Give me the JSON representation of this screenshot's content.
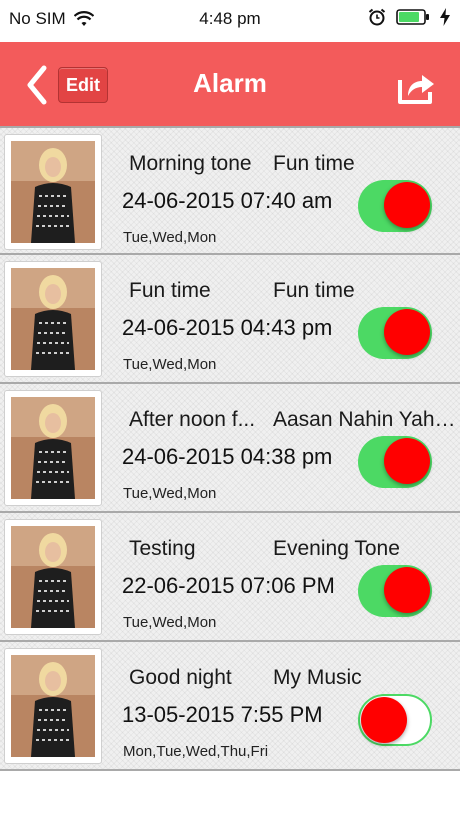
{
  "status_bar": {
    "carrier": "No SIM",
    "time": "4:48 pm"
  },
  "header": {
    "edit_label": "Edit",
    "title": "Alarm",
    "bg_color": "#f35b5b",
    "icons": [
      "chevron-left-icon",
      "share-icon"
    ]
  },
  "alarms": [
    {
      "name": "Morning tone",
      "tone": "Fun time",
      "datetime": "24-06-2015 07:40 am",
      "days": "Tue,Wed,Mon",
      "enabled": true
    },
    {
      "name": "Fun time",
      "tone": "Fun time",
      "datetime": "24-06-2015 04:43 pm",
      "days": "Tue,Wed,Mon",
      "enabled": true
    },
    {
      "name": "After noon f...",
      "tone": "Aasan Nahin Yaha...",
      "datetime": "24-06-2015 04:38 pm",
      "days": "Tue,Wed,Mon",
      "enabled": true
    },
    {
      "name": "Testing",
      "tone": "Evening Tone",
      "datetime": "22-06-2015 07:06 PM",
      "days": "Tue,Wed,Mon",
      "enabled": true
    },
    {
      "name": "Good night",
      "tone": "My Music",
      "datetime": "13-05-2015 7:55 PM",
      "days": "Mon,Tue,Wed,Thu,Fri",
      "enabled": false
    }
  ],
  "colors": {
    "toggle_on": "#4cd964",
    "toggle_knob": "#ff0000"
  }
}
